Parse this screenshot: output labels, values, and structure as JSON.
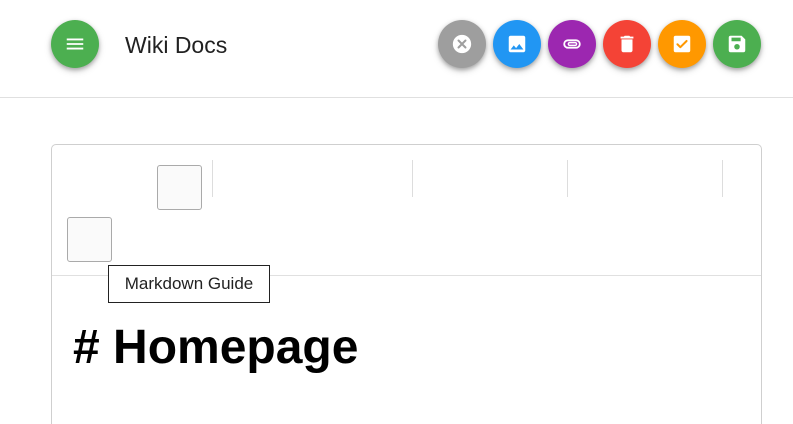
{
  "header": {
    "title": "Wiki Docs",
    "actions": [
      {
        "name": "close",
        "color": "#9e9e9e"
      },
      {
        "name": "image",
        "color": "#2196f3"
      },
      {
        "name": "attachment",
        "color": "#9c27b0"
      },
      {
        "name": "delete",
        "color": "#f44336"
      },
      {
        "name": "checkbox",
        "color": "#ff9800"
      },
      {
        "name": "save",
        "color": "#4caf50"
      }
    ],
    "menu_color": "#4caf50"
  },
  "editor": {
    "tooltip": "Markdown Guide",
    "content_heading": "# Homepage"
  }
}
